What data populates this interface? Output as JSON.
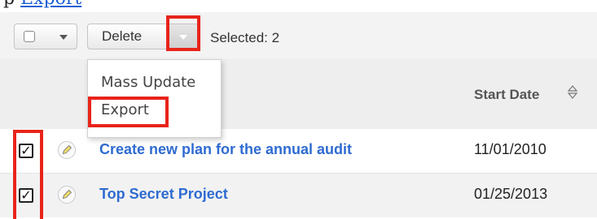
{
  "top_text": {
    "prefix": "p",
    "link": "Export"
  },
  "toolbar": {
    "delete_label": "Delete",
    "selected_text": "Selected: 2"
  },
  "menu": {
    "items": [
      {
        "label": "Mass Update"
      },
      {
        "label": "Export"
      }
    ]
  },
  "table": {
    "columns": {
      "start_date": "Start Date"
    },
    "rows": [
      {
        "name": "Create new plan for the annual audit",
        "start_date": "11/01/2010",
        "checked": true
      },
      {
        "name": "Top Secret Project",
        "start_date": "01/25/2013",
        "checked": true
      }
    ]
  },
  "colors": {
    "highlight": "#e8241a",
    "link": "#2f6bd1",
    "toolbar_bg": "#f3f3f3"
  },
  "icons": {
    "dropdown": "caret-down-icon",
    "sort": "sort-icon",
    "edit": "pencil-icon",
    "checkbox": "checkbox-checked-icon"
  }
}
